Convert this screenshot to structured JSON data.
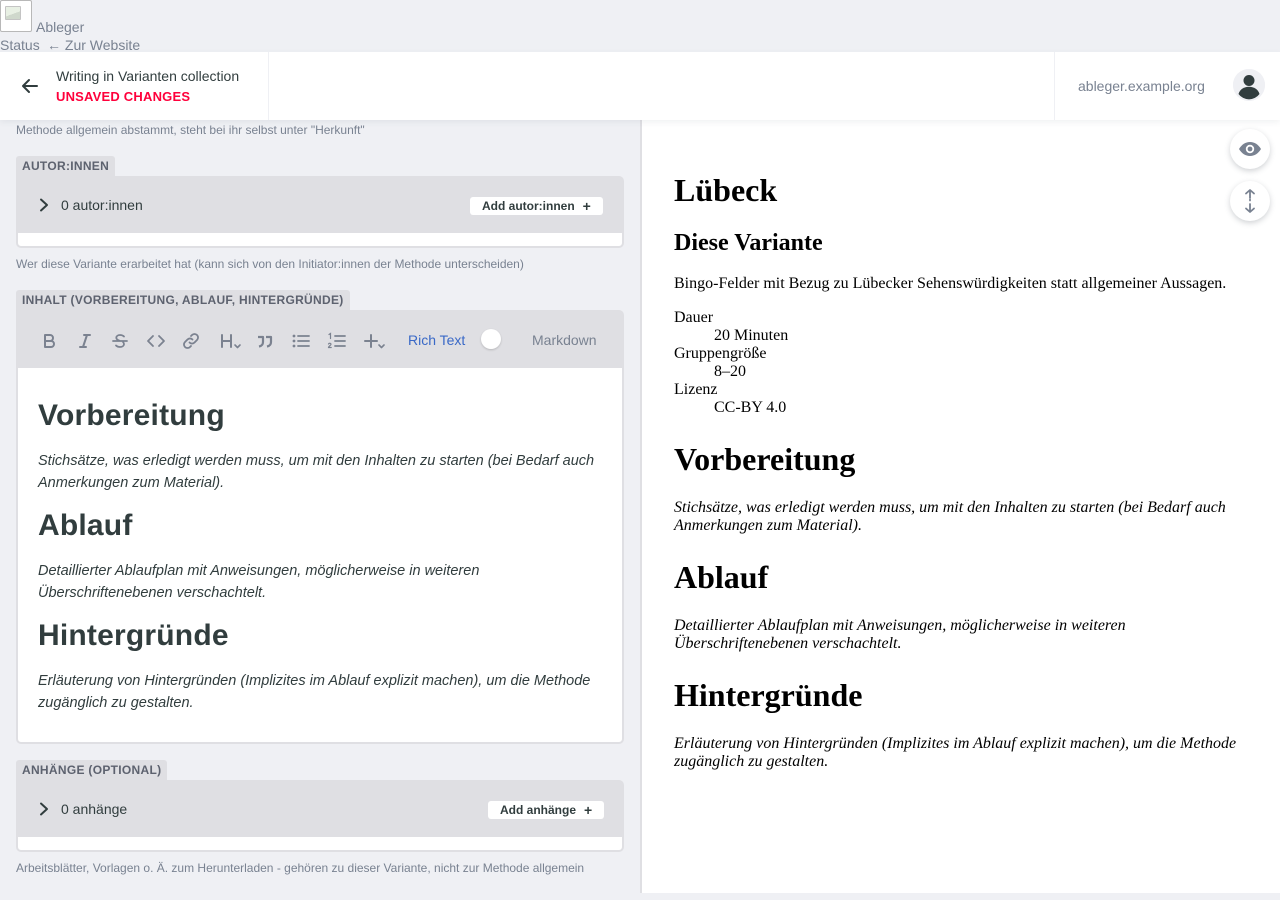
{
  "site": {
    "name": "Ableger",
    "status_link": "Status",
    "back_link": "← Zur Website",
    "url": "ableger.example.org"
  },
  "editor": {
    "collection_title": "Writing in Varianten collection",
    "status": "UNSAVED CHANGES",
    "status_color": "#ff003b"
  },
  "form": {
    "prev_hint_partial": "Methode allgemein abstammt, steht bei ihr selbst unter \"Herkunft\"",
    "authors": {
      "label": "AUTOR:INNEN",
      "count": "0 autor:innen",
      "add_label": "Add autor:innen",
      "hint": "Wer diese Variante erarbeitet hat (kann sich von den Initiator:innen der Methode unterscheiden)"
    },
    "content": {
      "label": "INHALT (VORBEREITUNG, ABLAUF, HINTERGRÜNDE)",
      "toolbar": {
        "icons": [
          "bold-icon",
          "italic-icon",
          "strikethrough-icon",
          "code-icon",
          "link-icon",
          "heading-icon",
          "quote-icon",
          "bulleted-list-icon",
          "numbered-list-icon",
          "add-component-icon"
        ],
        "rich_text_label": "Rich Text",
        "markdown_label": "Markdown",
        "rich_text_active": true
      },
      "sections": [
        {
          "heading": "Vorbereitung",
          "text": "Stichsätze, was erledigt werden muss, um mit den Inhalten zu starten (bei Bedarf auch Anmerkungen zum Material)."
        },
        {
          "heading": "Ablauf",
          "text": "Detaillierter Ablaufplan mit Anweisungen, möglicherweise in weiteren Überschriftenebenen verschachtelt."
        },
        {
          "heading": "Hintergründe",
          "text": "Erläuterung von Hintergründen (Implizites im Ablauf explizit machen), um die Methode zugänglich zu gestalten."
        }
      ]
    },
    "attachments": {
      "label": "ANHÄNGE (OPTIONAL)",
      "count": "0 anhänge",
      "add_label": "Add anhänge",
      "hint": "Arbeitsblätter, Vorlagen o. Ä. zum Herunterladen - gehören zu dieser Variante, nicht zur Methode allgemein"
    }
  },
  "preview": {
    "title": "Lübeck",
    "variant_heading": "Diese Variante",
    "description": "Bingo-Felder mit Bezug zu Lübecker Sehenswürdigkeiten statt allgemeiner Aussagen.",
    "meta": [
      {
        "term": "Dauer",
        "value": "20 Minuten"
      },
      {
        "term": "Gruppengröße",
        "value": "8–20"
      },
      {
        "term": "Lizenz",
        "value": "CC-BY 4.0"
      }
    ],
    "sections": [
      {
        "heading": "Vorbereitung",
        "text": "Stichsätze, was erledigt werden muss, um mit den Inhalten zu starten (bei Bedarf auch Anmerkungen zum Material)."
      },
      {
        "heading": "Ablauf",
        "text": "Detaillierter Ablaufplan mit Anweisungen, möglicherweise in weiteren Überschriftenebenen verschachtelt."
      },
      {
        "heading": "Hintergründe",
        "text": "Erläuterung von Hintergründen (Implizites im Ablauf explizit machen), um die Methode zugänglich zu gestalten."
      }
    ],
    "controls": [
      "eye-icon",
      "scroll-sync-icon"
    ]
  },
  "colors": {
    "accent": "#3a69c7",
    "background": "#eff0f4",
    "control": "#dfdfe3",
    "text": "#313d3e",
    "muted": "#798291"
  }
}
